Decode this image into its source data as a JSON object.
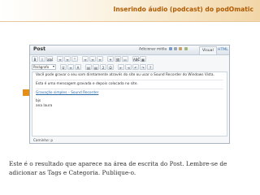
{
  "slide": {
    "title": "Inserindo áudio (podcast) do podOmatic",
    "caption": "Este é o resultado que aparece na área de escrita do Post. Lembre-se de adicionar as Tags e Categoria. Publique-o."
  },
  "editor": {
    "header_label": "Post",
    "add_media_label": "Adicionar mídia",
    "tabs": [
      "Visual",
      "HTML"
    ],
    "format_select": "Parágrafo",
    "toolbar_row1": [
      "B",
      "I",
      "abc",
      "≡",
      "≡",
      "“",
      "≡",
      "≡",
      "≡",
      "⚭",
      "⛓",
      "▭",
      "ABC",
      "▦"
    ],
    "toolbar_row2": [
      "U",
      "≡",
      "A",
      "▤",
      "▤",
      "2",
      "Ω",
      "⇤",
      "⇥",
      "↶",
      "↷",
      "?"
    ],
    "content": [
      "Você pode gravar o seu som diretamente através do site ou usar o Sound Recorder do Windows Vista.",
      "Esta é uma mensagem gravada e depois colocada no site.",
      "Gravação simples – Sound Recorder",
      "bjs",
      "ana laura"
    ],
    "word_count": "Caminho: p"
  },
  "colors": {
    "title": "#b05a00",
    "marker": "#e38f1a",
    "link": "#2c6aa6"
  }
}
